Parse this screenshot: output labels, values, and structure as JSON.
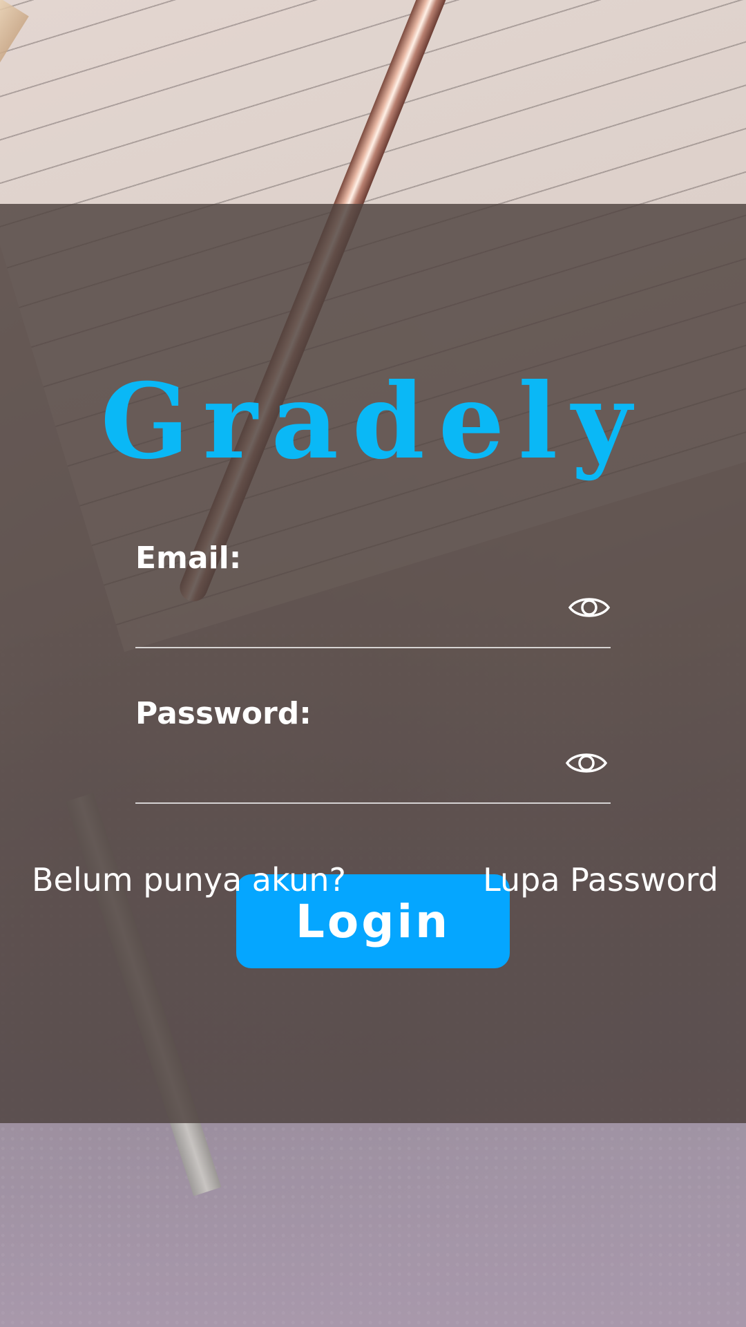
{
  "app": {
    "logo_text": "Gradely"
  },
  "form": {
    "email_label": "Email:",
    "email_value": "",
    "password_label": "Password:",
    "password_value": "",
    "login_label": "Login"
  },
  "footer": {
    "register_link": "Belum punya akun?",
    "forgot_link": "Lupa Password"
  },
  "colors": {
    "logo": "#0ab8f6",
    "button": "#05a6ff",
    "overlay": "#4e423e"
  },
  "icons": {
    "email_toggle": "eye-icon",
    "password_toggle": "eye-icon"
  }
}
